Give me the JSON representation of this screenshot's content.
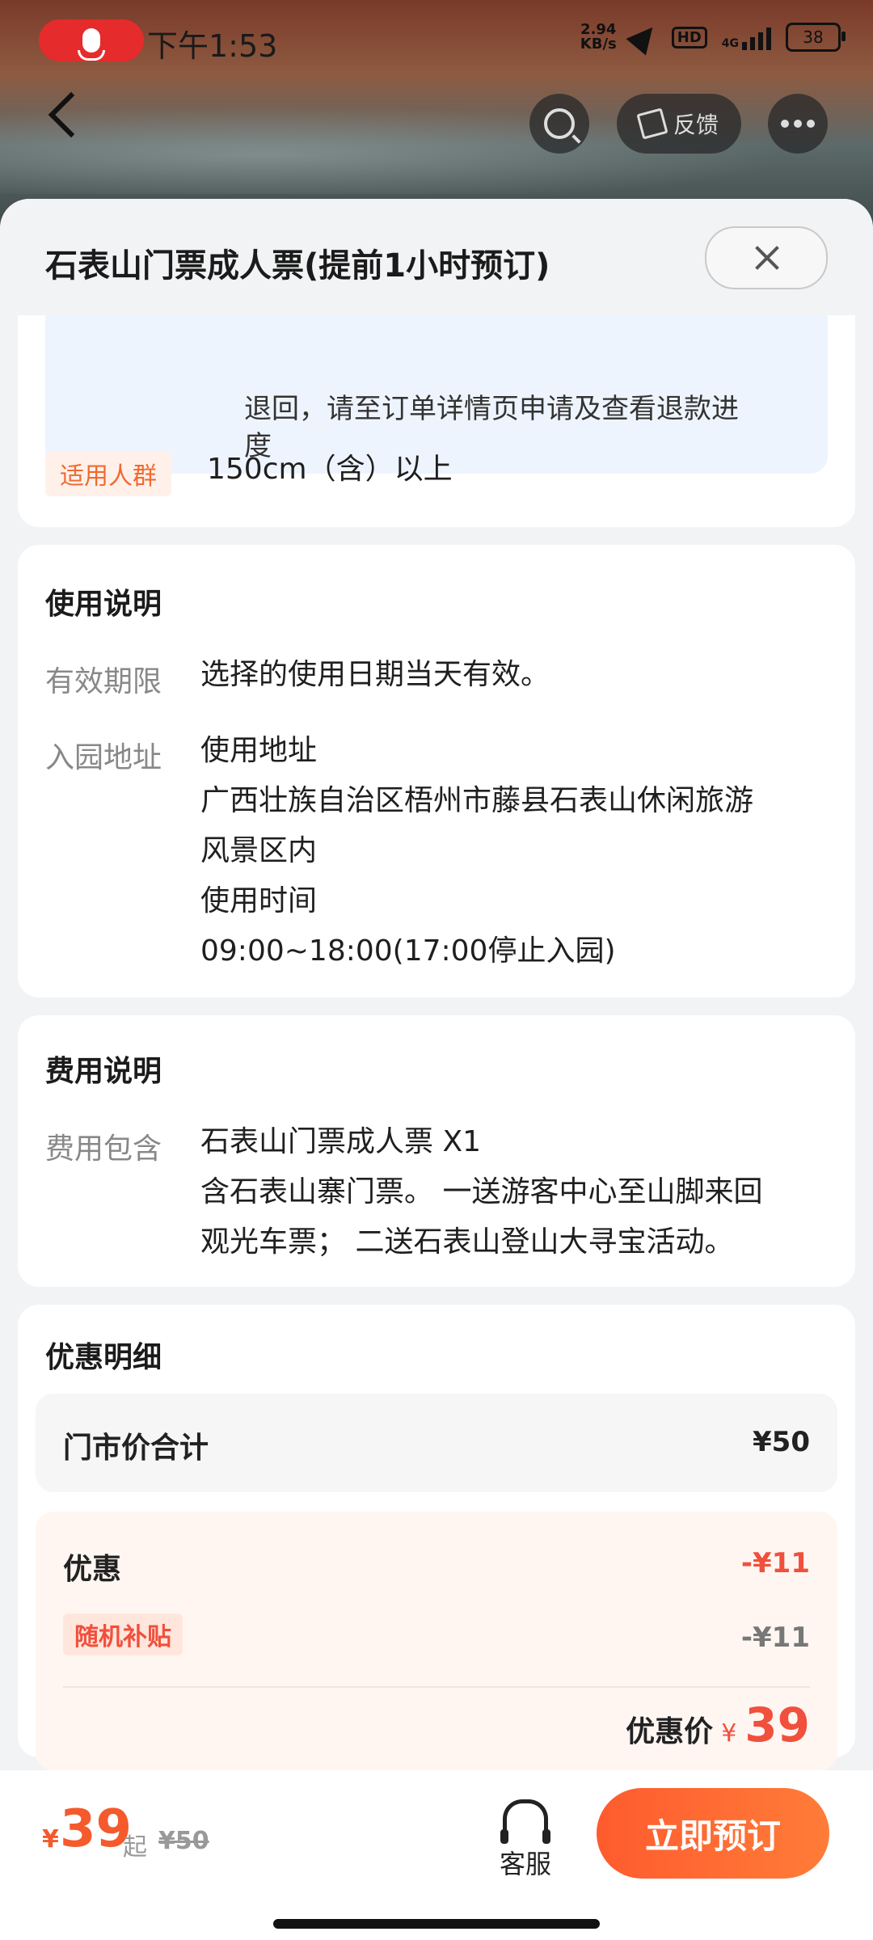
{
  "status_bar": {
    "time": "下午1:53",
    "net_speed_top": "2.94",
    "net_speed_unit": "KB/s",
    "hd": "HD",
    "net_type": "4G",
    "battery": "38"
  },
  "nav": {
    "feedback_label": "反馈"
  },
  "sheet": {
    "title": "石表山门票成人票(提前1小时预订)"
  },
  "refund": {
    "text_line1": "退回，请至订单详情页申请及查看退款进",
    "text_line2": "度"
  },
  "audience": {
    "tag": "适用人群",
    "value": "150cm（含）以上"
  },
  "usage": {
    "title": "使用说明",
    "validity_label": "有效期限",
    "validity_value": "选择的使用日期当天有效。",
    "address_label": "入园地址",
    "address_lines": [
      "使用地址",
      "广西壮族自治区梧州市藤县石表山休闲旅游",
      "风景区内",
      "使用时间",
      "09:00~18:00(17:00停止入园)"
    ]
  },
  "fees": {
    "title": "费用说明",
    "include_label": "费用包含",
    "lines": [
      "石表山门票成人票 X1",
      "含石表山寨门票。 一送游客中心至山脚来回",
      "观光车票； 二送石表山登山大寻宝活动。"
    ]
  },
  "discount": {
    "title": "优惠明细",
    "market_label": "门市价合计",
    "market_value": "¥50",
    "discount_label": "优惠",
    "discount_value": "-¥11",
    "random_tag": "随机补贴",
    "random_value": "-¥11",
    "final_label": "优惠价",
    "final_yen": "¥",
    "final_value": "39"
  },
  "bottom": {
    "yen": "¥",
    "price": "39",
    "qi": "起",
    "original": "¥50",
    "service_label": "客服",
    "book_label": "立即预订"
  },
  "colors": {
    "accent": "#f45a2c",
    "discount_red": "#f0503c"
  }
}
